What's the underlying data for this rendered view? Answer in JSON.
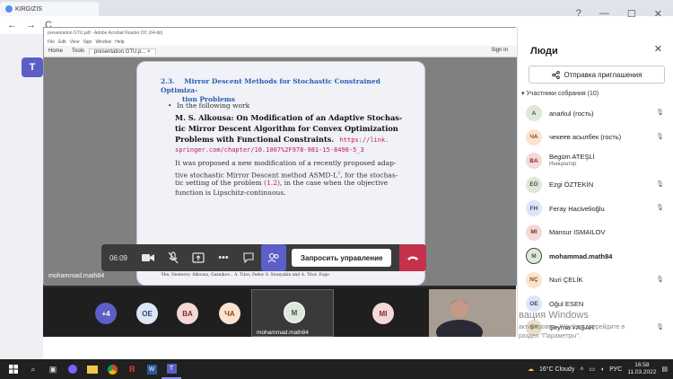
{
  "browser": {
    "tab_label": "KIRGIZIS",
    "back": "←",
    "forward": "→",
    "reload": "C"
  },
  "window": {
    "help": "?",
    "minimize": "—",
    "maximize": "☐",
    "close": "✕"
  },
  "acrobat": {
    "title_bar": "presentation GTU.pdf - Adobe Acrobat Reader DC (64-bit)",
    "menu": [
      "File",
      "Edit",
      "View",
      "Sign",
      "Window",
      "Help"
    ],
    "tabs": [
      "Home",
      "Tools",
      "presentation GTU.p... ×"
    ],
    "sign_in": "Sign In"
  },
  "slide": {
    "section_number": "2.3.",
    "section_title_1": "Mirror Descent Methods for Stochastic Constrained Optimiza-",
    "section_title_2": "tion Problems",
    "bullet": "In the following work",
    "paper_1": "M. S. Alkousa: On Modification of an Adaptive Stochas-",
    "paper_2": "tic Mirror Descent Algorithm for Convex Optimization",
    "paper_3": "Problems with Functional Constraints.",
    "link_1": "https://link.",
    "link_2": "springer.com/chapter/10.1007%2F978-981-15-8498-5_3",
    "body_1": "It was proposed a new modification of a recently proposed adap-",
    "body_2": "tive stochastic Mirror Descent method ASMD-L",
    "body_2b": ", for the stochas-",
    "body_3a": "tic setting of the problem ",
    "body_3ref": "(1.2)",
    "body_3b": ", in the case when the objective",
    "body_4": "function is Lipschitz-continuous.",
    "sup": "3",
    "footnote": "³Ibe, Nesterov, Alkousa, Gasnikov... A. Titov, Fedor S. Stonyakin and A. Titov. Fogo"
  },
  "controls": {
    "timer": "06:09",
    "request_control": "Запросить управление"
  },
  "sharer_name": "mohammad.math84",
  "strip": {
    "avatars": [
      {
        "initials": "+4",
        "bg": "#5b5fc7",
        "fg": "#ffffff"
      },
      {
        "initials": "OE",
        "bg": "#dde6f3",
        "fg": "#2b4a7a"
      },
      {
        "initials": "BA",
        "bg": "#f4d9d9",
        "fg": "#8a2a2a"
      },
      {
        "initials": "ЧА",
        "bg": "#fbe3cf",
        "fg": "#8a4a10"
      },
      {
        "initials": "MI",
        "bg": "#f4d9d9",
        "fg": "#8a2a2a"
      }
    ],
    "self_initial": "M",
    "self_name": "mohammad.math84"
  },
  "panel": {
    "title": "Люди",
    "close": "✕",
    "invite": "Отправка приглашения",
    "section": "Участники собрания (10)",
    "participants": [
      {
        "initials": "A",
        "name": "anarkul (гость)",
        "sub": "",
        "bg": "#dfe7dd",
        "fg": "#3d5a36",
        "muted": true
      },
      {
        "initials": "ЧА",
        "name": "чекеев асылбек (гость)",
        "sub": "",
        "bg": "#fbe3cf",
        "fg": "#8a4a10",
        "muted": true
      },
      {
        "initials": "BA",
        "name": "Begüm ATEŞLİ",
        "sub": "Инициатор",
        "bg": "#f4d9d9",
        "fg": "#8a2a2a",
        "muted": false
      },
      {
        "initials": "EÖ",
        "name": "Ezgi ÖZTEKİN",
        "sub": "",
        "bg": "#dfe7dd",
        "fg": "#3d5a36",
        "muted": true
      },
      {
        "initials": "FH",
        "name": "Feray Hacivelioğlu",
        "sub": "",
        "bg": "#dde6f3",
        "fg": "#2b4a7a",
        "muted": true
      },
      {
        "initials": "MI",
        "name": "Mansur ISMAILOV",
        "sub": "",
        "bg": "#f4d9d9",
        "fg": "#8a2a2a",
        "muted": false
      },
      {
        "initials": "M",
        "name": "mohammad.math84",
        "sub": "",
        "bg": "#dfe7dd",
        "fg": "#3d5a36",
        "muted": false
      },
      {
        "initials": "NÇ",
        "name": "Nuri ÇELİK",
        "sub": "",
        "bg": "#fbe3cf",
        "fg": "#8a4a10",
        "muted": true
      },
      {
        "initials": "OE",
        "name": "Oğul ESEN",
        "sub": "",
        "bg": "#dde6f3",
        "fg": "#2b4a7a",
        "muted": false
      },
      {
        "initials": "ŞY",
        "name": "Şeyma YAŞAR",
        "sub": "",
        "bg": "#e6e0c8",
        "fg": "#6a5a10",
        "muted": true
      }
    ]
  },
  "activation": {
    "line1": "вация Windows",
    "line2": "активировать Windows, перейдите в",
    "line3": "раздел \"Параметры\"."
  },
  "taskbar": {
    "weather": "16°C  Cloudy",
    "lang": "РУС",
    "time": "16:58",
    "date": "11.03.2022"
  }
}
